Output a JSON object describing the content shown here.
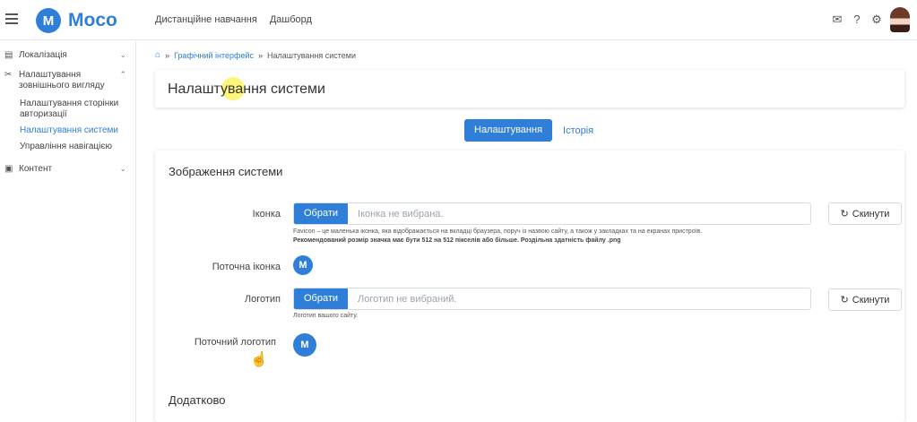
{
  "app": {
    "logo_letter": "M",
    "logo_text": "Moco",
    "nav": [
      "Дистанційне навчання",
      "Дашборд"
    ],
    "icons": [
      "mail-icon",
      "help-icon",
      "gear-icon"
    ],
    "brand_color": "#2f7fd9"
  },
  "sidebar": {
    "items": [
      {
        "label": "Локалізація",
        "icon": "localization-icon"
      },
      {
        "label": "Налаштування зовнішнього вигляду",
        "icon": "tools-icon"
      },
      {
        "label": "Контент",
        "icon": "content-icon"
      }
    ],
    "subitems": [
      {
        "label": "Налаштування сторінки авторизації"
      },
      {
        "label": "Налаштування системи"
      },
      {
        "label": "Управління навігацією"
      }
    ]
  },
  "breadcrumb": {
    "home_icon": "home-icon",
    "sep": "»",
    "link": "Графічний інтерфейс",
    "current": "Налаштування системи"
  },
  "page": {
    "title": "Налаштування системи",
    "tabs": {
      "active": "Налаштування",
      "other": "Історія"
    }
  },
  "system_images": {
    "section_title": "Зображення системи",
    "icon_row": {
      "label": "Іконка",
      "button": "Обрати",
      "placeholder": "Іконка не вибрана.",
      "reset": "Скинути",
      "help_line1": "Favicon – це маленька іконка, яка відображається на вкладці браузера, поруч із назвою сайту, а також у закладках та на екранах пристроїв.",
      "help_line2": "Рекомендований розмір значка має бути 512 на 512 пікселів або більше. Роздільна здатність файлу .png"
    },
    "current_icon_label": "Поточна іконка",
    "logo_row": {
      "label": "Логотип",
      "button": "Обрати",
      "placeholder": "Логотип не вибраний.",
      "reset": "Скинути",
      "help_line1": "Логотип вашого сайту."
    },
    "current_logo_label": "Поточний логотип"
  },
  "additional": {
    "section_title": "Додатково"
  }
}
